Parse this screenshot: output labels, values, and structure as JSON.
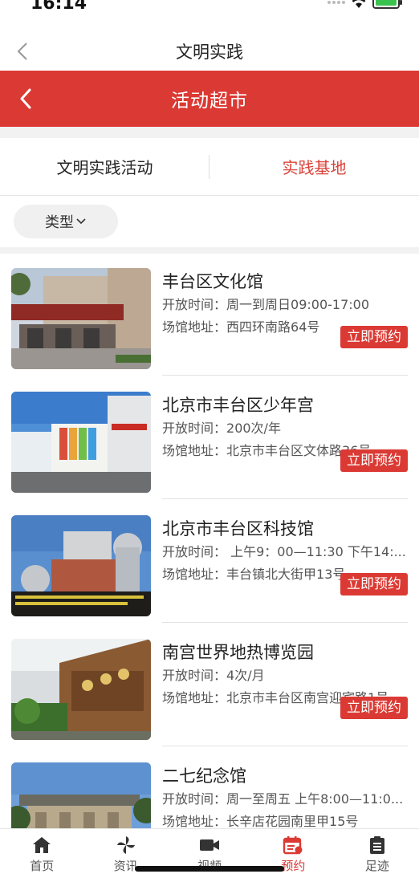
{
  "status": {
    "time": "16:14",
    "battery_level": 1.0
  },
  "top_nav": {
    "title": "文明实践"
  },
  "header": {
    "title": "活动超市"
  },
  "tabs": [
    {
      "label": "文明实践活动"
    },
    {
      "label": "实践基地"
    }
  ],
  "filter": {
    "label": "类型"
  },
  "labels": {
    "open": "开放时间：",
    "addr": "场馆地址：",
    "book": "立即预约"
  },
  "venues": [
    {
      "name": "丰台区文化馆",
      "open_time": "周一到周日09:00-17:00",
      "address": "西四环南路64号"
    },
    {
      "name": "北京市丰台区少年宫",
      "open_time": "200次/年",
      "address": "北京市丰台区文体路36号..."
    },
    {
      "name": "北京市丰台区科技馆",
      "open_time": " 上午9：00—11:30 下午14:...",
      "address": "丰台镇北大街甲13号"
    },
    {
      "name": "南宫世界地热博览园",
      "open_time": "4次/月",
      "address": "北京市丰台区南宫迎宾路1号"
    },
    {
      "name": "二七纪念馆",
      "open_time": "周一至周五 上午8:00—11:0...",
      "address": "长辛店花园南里甲15号"
    }
  ],
  "tabbar": [
    {
      "label": "首页",
      "icon": "home-icon"
    },
    {
      "label": "资讯",
      "icon": "pinwheel-icon"
    },
    {
      "label": "视频",
      "icon": "video-camera-icon"
    },
    {
      "label": "预约",
      "icon": "calendar-icon"
    },
    {
      "label": "足迹",
      "icon": "clipboard-icon"
    }
  ],
  "colors": {
    "accent": "#db3a34",
    "battery": "#3ac24f"
  }
}
